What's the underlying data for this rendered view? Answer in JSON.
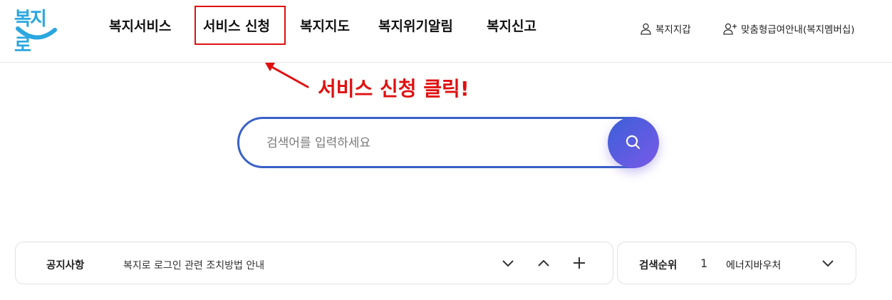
{
  "header": {
    "logo_text": "복지로",
    "nav": [
      {
        "label": "복지서비스"
      },
      {
        "label": "서비스 신청"
      },
      {
        "label": "복지지도"
      },
      {
        "label": "복지위기알림"
      },
      {
        "label": "복지신고"
      }
    ],
    "utility": [
      {
        "label": "복지지갑",
        "icon": "user-icon"
      },
      {
        "label": "맞춤형급여안내(복지멤버십)",
        "icon": "user-plus-icon"
      }
    ]
  },
  "annotation": {
    "text": "서비스 신청 클릭!",
    "color": "#e01010"
  },
  "search": {
    "placeholder": "검색어를 입력하세요",
    "value": ""
  },
  "notice": {
    "label": "공지사항",
    "text": "복지로 로그인 관련 조치방법 안내"
  },
  "rank": {
    "label": "검색순위",
    "number": "1",
    "text": "에너지바우처"
  },
  "colors": {
    "accent": "#3a61c7",
    "annotation": "#e01010",
    "logo": "#2aa7df"
  }
}
